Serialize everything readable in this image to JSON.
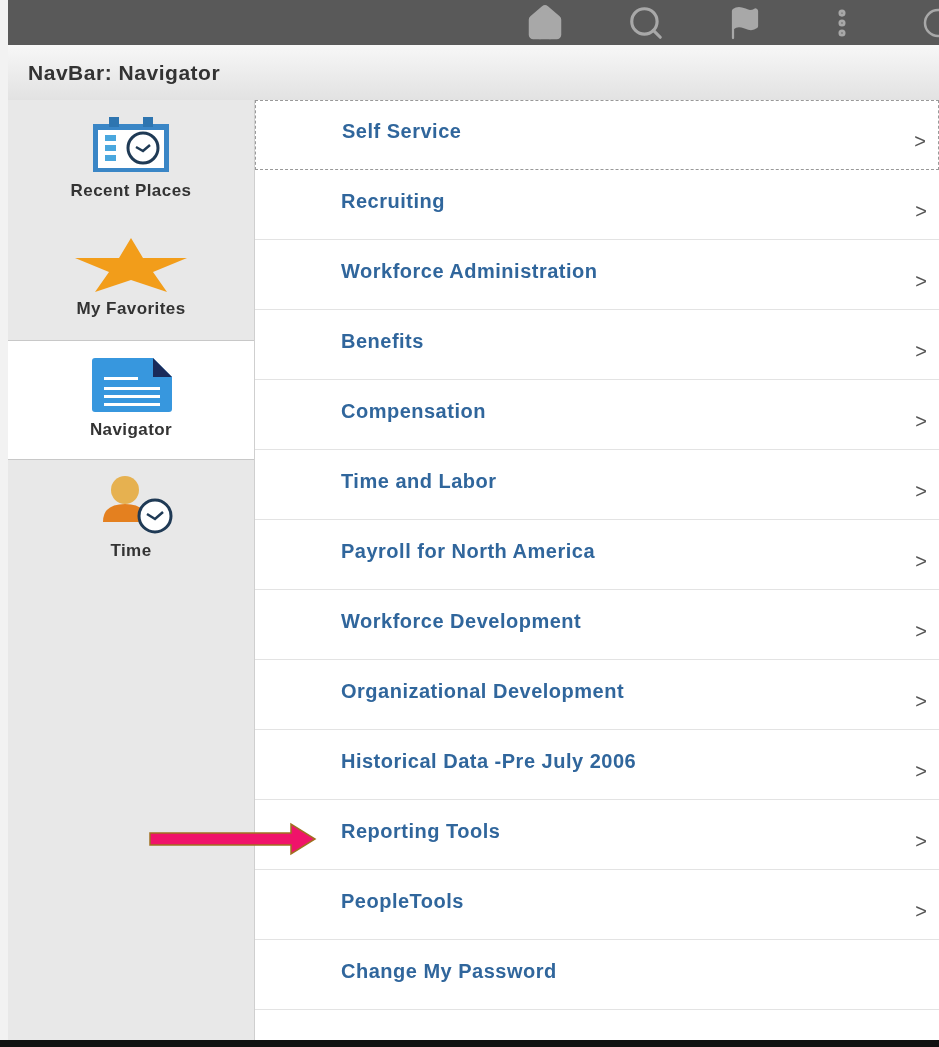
{
  "header": {
    "title": "NavBar: Navigator"
  },
  "sidebar": {
    "items": [
      {
        "label": "Recent Places",
        "kind": "recent",
        "selected": false
      },
      {
        "label": "My Favorites",
        "kind": "favorites",
        "selected": false
      },
      {
        "label": "Navigator",
        "kind": "navigator",
        "selected": true
      },
      {
        "label": "Time",
        "kind": "time",
        "selected": false
      }
    ]
  },
  "menu": {
    "items": [
      {
        "label": "Self Service",
        "chevron": ">",
        "focused": true,
        "pointed": false
      },
      {
        "label": "Recruiting",
        "chevron": ">",
        "focused": false,
        "pointed": false
      },
      {
        "label": "Workforce Administration",
        "chevron": ">",
        "focused": false,
        "pointed": false
      },
      {
        "label": "Benefits",
        "chevron": ">",
        "focused": false,
        "pointed": false
      },
      {
        "label": "Compensation",
        "chevron": ">",
        "focused": false,
        "pointed": false
      },
      {
        "label": "Time and Labor",
        "chevron": ">",
        "focused": false,
        "pointed": false
      },
      {
        "label": "Payroll for North America",
        "chevron": ">",
        "focused": false,
        "pointed": false
      },
      {
        "label": "Workforce Development",
        "chevron": ">",
        "focused": false,
        "pointed": false
      },
      {
        "label": "Organizational Development",
        "chevron": ">",
        "focused": false,
        "pointed": false
      },
      {
        "label": "Historical Data -Pre July 2006",
        "chevron": ">",
        "focused": false,
        "pointed": false
      },
      {
        "label": "Reporting Tools",
        "chevron": ">",
        "focused": false,
        "pointed": true
      },
      {
        "label": "PeopleTools",
        "chevron": ">",
        "focused": false,
        "pointed": false
      },
      {
        "label": "Change My Password",
        "focused": false,
        "pointed": false
      }
    ]
  }
}
